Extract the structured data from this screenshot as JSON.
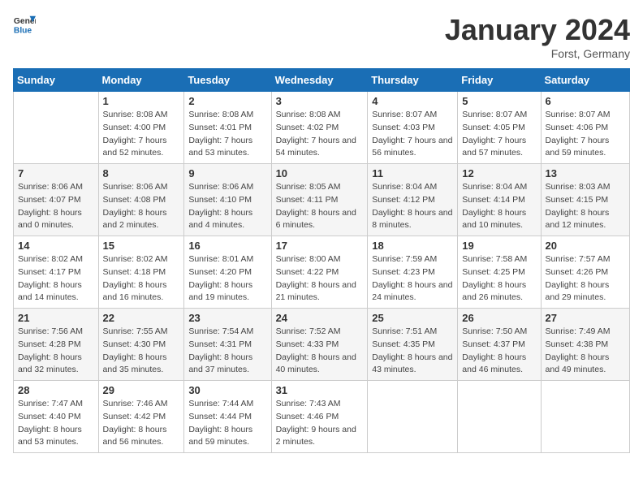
{
  "logo": {
    "line1": "General",
    "line2": "Blue"
  },
  "title": "January 2024",
  "location": "Forst, Germany",
  "weekdays": [
    "Sunday",
    "Monday",
    "Tuesday",
    "Wednesday",
    "Thursday",
    "Friday",
    "Saturday"
  ],
  "weeks": [
    [
      {
        "day": "",
        "sunrise": "",
        "sunset": "",
        "daylight": ""
      },
      {
        "day": "1",
        "sunrise": "Sunrise: 8:08 AM",
        "sunset": "Sunset: 4:00 PM",
        "daylight": "Daylight: 7 hours and 52 minutes."
      },
      {
        "day": "2",
        "sunrise": "Sunrise: 8:08 AM",
        "sunset": "Sunset: 4:01 PM",
        "daylight": "Daylight: 7 hours and 53 minutes."
      },
      {
        "day": "3",
        "sunrise": "Sunrise: 8:08 AM",
        "sunset": "Sunset: 4:02 PM",
        "daylight": "Daylight: 7 hours and 54 minutes."
      },
      {
        "day": "4",
        "sunrise": "Sunrise: 8:07 AM",
        "sunset": "Sunset: 4:03 PM",
        "daylight": "Daylight: 7 hours and 56 minutes."
      },
      {
        "day": "5",
        "sunrise": "Sunrise: 8:07 AM",
        "sunset": "Sunset: 4:05 PM",
        "daylight": "Daylight: 7 hours and 57 minutes."
      },
      {
        "day": "6",
        "sunrise": "Sunrise: 8:07 AM",
        "sunset": "Sunset: 4:06 PM",
        "daylight": "Daylight: 7 hours and 59 minutes."
      }
    ],
    [
      {
        "day": "7",
        "sunrise": "Sunrise: 8:06 AM",
        "sunset": "Sunset: 4:07 PM",
        "daylight": "Daylight: 8 hours and 0 minutes."
      },
      {
        "day": "8",
        "sunrise": "Sunrise: 8:06 AM",
        "sunset": "Sunset: 4:08 PM",
        "daylight": "Daylight: 8 hours and 2 minutes."
      },
      {
        "day": "9",
        "sunrise": "Sunrise: 8:06 AM",
        "sunset": "Sunset: 4:10 PM",
        "daylight": "Daylight: 8 hours and 4 minutes."
      },
      {
        "day": "10",
        "sunrise": "Sunrise: 8:05 AM",
        "sunset": "Sunset: 4:11 PM",
        "daylight": "Daylight: 8 hours and 6 minutes."
      },
      {
        "day": "11",
        "sunrise": "Sunrise: 8:04 AM",
        "sunset": "Sunset: 4:12 PM",
        "daylight": "Daylight: 8 hours and 8 minutes."
      },
      {
        "day": "12",
        "sunrise": "Sunrise: 8:04 AM",
        "sunset": "Sunset: 4:14 PM",
        "daylight": "Daylight: 8 hours and 10 minutes."
      },
      {
        "day": "13",
        "sunrise": "Sunrise: 8:03 AM",
        "sunset": "Sunset: 4:15 PM",
        "daylight": "Daylight: 8 hours and 12 minutes."
      }
    ],
    [
      {
        "day": "14",
        "sunrise": "Sunrise: 8:02 AM",
        "sunset": "Sunset: 4:17 PM",
        "daylight": "Daylight: 8 hours and 14 minutes."
      },
      {
        "day": "15",
        "sunrise": "Sunrise: 8:02 AM",
        "sunset": "Sunset: 4:18 PM",
        "daylight": "Daylight: 8 hours and 16 minutes."
      },
      {
        "day": "16",
        "sunrise": "Sunrise: 8:01 AM",
        "sunset": "Sunset: 4:20 PM",
        "daylight": "Daylight: 8 hours and 19 minutes."
      },
      {
        "day": "17",
        "sunrise": "Sunrise: 8:00 AM",
        "sunset": "Sunset: 4:22 PM",
        "daylight": "Daylight: 8 hours and 21 minutes."
      },
      {
        "day": "18",
        "sunrise": "Sunrise: 7:59 AM",
        "sunset": "Sunset: 4:23 PM",
        "daylight": "Daylight: 8 hours and 24 minutes."
      },
      {
        "day": "19",
        "sunrise": "Sunrise: 7:58 AM",
        "sunset": "Sunset: 4:25 PM",
        "daylight": "Daylight: 8 hours and 26 minutes."
      },
      {
        "day": "20",
        "sunrise": "Sunrise: 7:57 AM",
        "sunset": "Sunset: 4:26 PM",
        "daylight": "Daylight: 8 hours and 29 minutes."
      }
    ],
    [
      {
        "day": "21",
        "sunrise": "Sunrise: 7:56 AM",
        "sunset": "Sunset: 4:28 PM",
        "daylight": "Daylight: 8 hours and 32 minutes."
      },
      {
        "day": "22",
        "sunrise": "Sunrise: 7:55 AM",
        "sunset": "Sunset: 4:30 PM",
        "daylight": "Daylight: 8 hours and 35 minutes."
      },
      {
        "day": "23",
        "sunrise": "Sunrise: 7:54 AM",
        "sunset": "Sunset: 4:31 PM",
        "daylight": "Daylight: 8 hours and 37 minutes."
      },
      {
        "day": "24",
        "sunrise": "Sunrise: 7:52 AM",
        "sunset": "Sunset: 4:33 PM",
        "daylight": "Daylight: 8 hours and 40 minutes."
      },
      {
        "day": "25",
        "sunrise": "Sunrise: 7:51 AM",
        "sunset": "Sunset: 4:35 PM",
        "daylight": "Daylight: 8 hours and 43 minutes."
      },
      {
        "day": "26",
        "sunrise": "Sunrise: 7:50 AM",
        "sunset": "Sunset: 4:37 PM",
        "daylight": "Daylight: 8 hours and 46 minutes."
      },
      {
        "day": "27",
        "sunrise": "Sunrise: 7:49 AM",
        "sunset": "Sunset: 4:38 PM",
        "daylight": "Daylight: 8 hours and 49 minutes."
      }
    ],
    [
      {
        "day": "28",
        "sunrise": "Sunrise: 7:47 AM",
        "sunset": "Sunset: 4:40 PM",
        "daylight": "Daylight: 8 hours and 53 minutes."
      },
      {
        "day": "29",
        "sunrise": "Sunrise: 7:46 AM",
        "sunset": "Sunset: 4:42 PM",
        "daylight": "Daylight: 8 hours and 56 minutes."
      },
      {
        "day": "30",
        "sunrise": "Sunrise: 7:44 AM",
        "sunset": "Sunset: 4:44 PM",
        "daylight": "Daylight: 8 hours and 59 minutes."
      },
      {
        "day": "31",
        "sunrise": "Sunrise: 7:43 AM",
        "sunset": "Sunset: 4:46 PM",
        "daylight": "Daylight: 9 hours and 2 minutes."
      },
      {
        "day": "",
        "sunrise": "",
        "sunset": "",
        "daylight": ""
      },
      {
        "day": "",
        "sunrise": "",
        "sunset": "",
        "daylight": ""
      },
      {
        "day": "",
        "sunrise": "",
        "sunset": "",
        "daylight": ""
      }
    ]
  ]
}
